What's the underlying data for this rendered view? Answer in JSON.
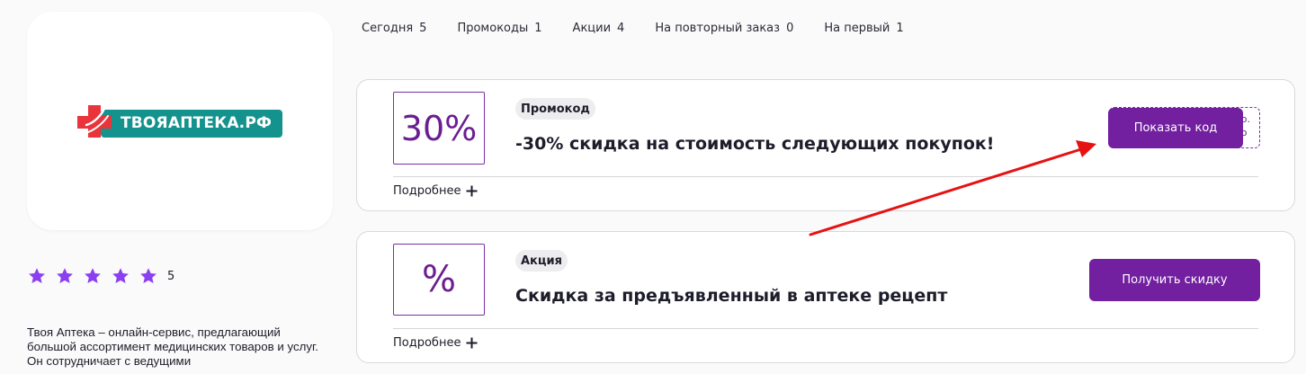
{
  "store": {
    "logo_text": "ТВОЯАПТЕКА.РФ",
    "rating": {
      "stars": 5,
      "value": "5"
    },
    "description": "Твоя Аптека – онлайн-сервис, предлагающий большой ассортимент медицинских товаров и услуг. Он сотрудничает с ведущими"
  },
  "tabs": [
    {
      "label": "Сегодня",
      "count": "5"
    },
    {
      "label": "Промокоды",
      "count": "1"
    },
    {
      "label": "Акции",
      "count": "4"
    },
    {
      "label": "На повторный заказ",
      "count": "0"
    },
    {
      "label": "На первый",
      "count": "1"
    }
  ],
  "offers": [
    {
      "badge": "30%",
      "tag": "Промокод",
      "title": "-30% скидка на стоимость следующих покупок!",
      "more_label": "Подробнее",
      "button_label": "Показать код",
      "code_peek": "о.\nо"
    },
    {
      "badge": "%",
      "tag": "Акция",
      "title": "Скидка за предъявленный в аптеке рецепт",
      "more_label": "Подробнее",
      "button_label": "Получить скидку"
    }
  ],
  "colors": {
    "accent": "#721fa0",
    "logo_teal": "#14928d",
    "logo_red": "#e8343a",
    "star": "#8b3ff0",
    "annotation_arrow": "#e61212"
  }
}
